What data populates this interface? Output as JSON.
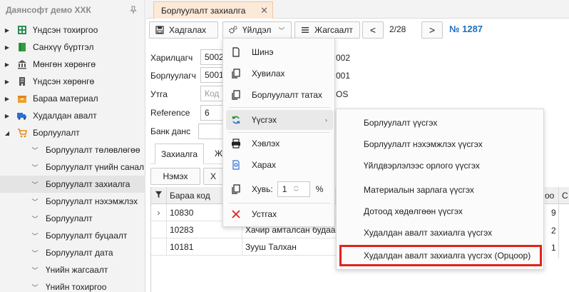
{
  "app": {
    "company": "Даянсофт демо ХХК"
  },
  "sidebar": {
    "items": [
      {
        "label": "Үндсэн тохиргоо",
        "icon": "settings-grid-icon",
        "color": "#2e8b57"
      },
      {
        "label": "Санхүү бүртгэл",
        "icon": "book-icon",
        "color": "#2e9e3e"
      },
      {
        "label": "Мөнгөн хөрөнгө",
        "icon": "bank-icon",
        "color": "#555555"
      },
      {
        "label": "Үндсэн хөрөнгө",
        "icon": "building-icon",
        "color": "#555555"
      },
      {
        "label": "Бараа материал",
        "icon": "box-icon",
        "color": "#f0a030"
      },
      {
        "label": "Худалдан авалт",
        "icon": "truck-icon",
        "color": "#2c6fd6"
      },
      {
        "label": "Борлуулалт",
        "icon": "cart-icon",
        "color": "#e48a1c"
      }
    ],
    "children": [
      {
        "label": "Борлуулалт төлөвлөгөө"
      },
      {
        "label": "Борлуулалт үнийн санал"
      },
      {
        "label": "Борлуулалт захиалга",
        "selected": true
      },
      {
        "label": "Борлуулалт нэхэмжлэх"
      },
      {
        "label": "Борлуулалт"
      },
      {
        "label": "Борлуулалт буцаалт"
      },
      {
        "label": "Борлуулалт дата"
      },
      {
        "label": "Үнийн жагсаалт"
      },
      {
        "label": "Үнийн тохиргоо"
      }
    ]
  },
  "tab": {
    "label": "Борлуулалт захиалга",
    "close": "✕",
    "bg": "#fde9d8"
  },
  "toolbar": {
    "save": "Хадгалах",
    "actions": "Үйлдэл",
    "list": "Жагсаалт",
    "prev": "<",
    "pager": "2/28",
    "next": ">",
    "doc_number": "№ 1287"
  },
  "form": {
    "customer_label": "Харилцагч",
    "customer_value": "5002",
    "customer_tail": "002",
    "seller_label": "Борлуулагч",
    "seller_value": "5001",
    "seller_tail": "001",
    "phone_label": "Утга",
    "phone_placeholder": "Код",
    "phone_tail": "OS",
    "reference_label": "Reference",
    "reference_value": "6",
    "bank_label": "Банк данс"
  },
  "inner_tabs": {
    "active": "Захиалга",
    "other": "Ж"
  },
  "grid": {
    "add_button": "Нэмэх",
    "second_button": "Х",
    "header_code": "Бараа код",
    "rows": [
      {
        "code": "10830",
        "name": "",
        "qty": "9"
      },
      {
        "code": "10283",
        "name": "Хачир амталсан будаа",
        "qty": "2"
      },
      {
        "code": "10181",
        "name": "Зууш Талхан",
        "qty": "1"
      }
    ],
    "edge_header_1": "оо",
    "edge_header_2": "С"
  },
  "menu": {
    "new": "Шинэ",
    "copy": "Хувилах",
    "take_sales": "Борлуулалт татах",
    "create": "Үүсгэх",
    "print": "Хэвлэх",
    "view": "Харах",
    "copies_label": "Хувь:",
    "copies_value": "1",
    "copies_unit": "%",
    "delete": "Устгах"
  },
  "submenu": {
    "items": [
      "Борлуулалт үүсгэх",
      "Борлуулалт нэхэмжлэх үүсгэх",
      "Үйлдвэрлэлээс орлого үүсгэх",
      "Материалын зарлага үүсгэх",
      "Дотоод хөдөлгөөн үүсгэх",
      "Худалдан авалт захиалга үүсгэх",
      "Худалдан авалт захиалга үүсгэх (Орцоор)"
    ],
    "highlight_color": "#e0231c"
  }
}
